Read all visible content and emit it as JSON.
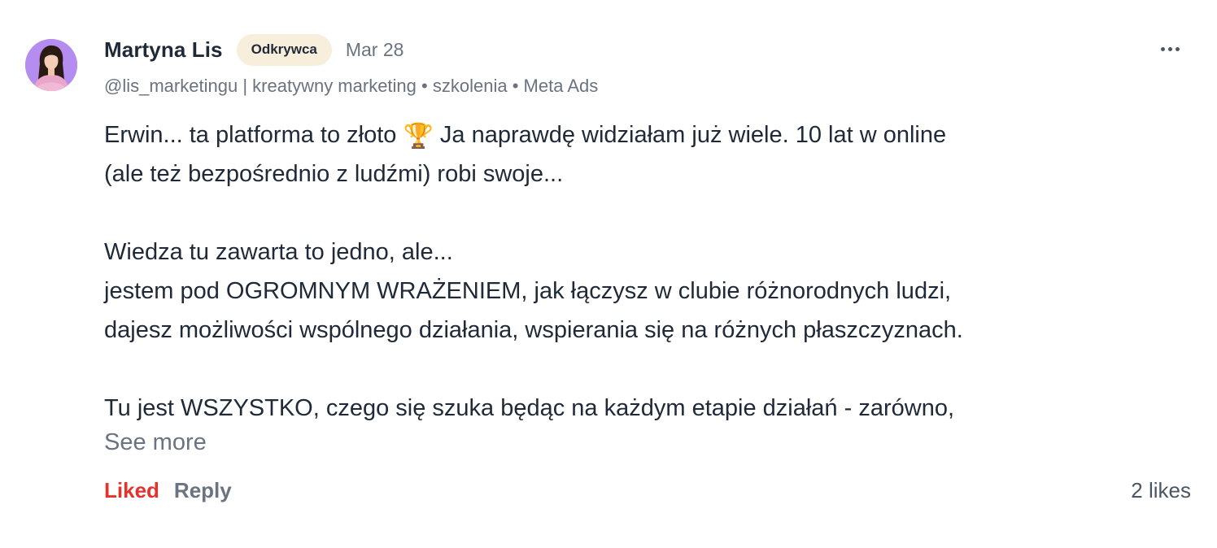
{
  "comment": {
    "author": {
      "name": "Martyna Lis",
      "badge": "Odkrywca",
      "date": "Mar 28",
      "handle": "@lis_marketingu",
      "separator": "|",
      "tagline_items": [
        "kreatywny marketing",
        "szkolenia",
        "Meta Ads"
      ],
      "tagline_bullet": "•"
    },
    "body": {
      "p1_before_emoji": "Erwin... ta platforma to złoto ",
      "emoji": "🏆",
      "p1_after_emoji": " Ja naprawdę widziałam już wiele. 10 lat  w online",
      "p1_line2": "(ale też bezpośrednio z ludźmi) robi swoje...",
      "p2_line1": "Wiedza tu zawarta to jedno, ale...",
      "p2_line2": "jestem pod OGROMNYM WRAŻENIEM, jak łączysz w clubie różnorodnych ludzi,",
      "p2_line3": "dajesz możliwości wspólnego działania, wspierania się na różnych płaszczyznach.",
      "p3_line1": "Tu jest WSZYSTKO, czego się szuka będąc na każdym etapie działań - zarówno,"
    },
    "see_more_label": "See more",
    "actions": {
      "liked_label": "Liked",
      "reply_label": "Reply",
      "likes_count": "2 likes"
    },
    "colors": {
      "liked": "#e5322d",
      "badge_bg": "#f8eedc",
      "avatar_bg": "#b58cf0",
      "muted_text": "#6b7280",
      "main_text": "#1f2937"
    },
    "icons": {
      "avatar": "avatar-photo",
      "more": "more-horizontal-icon",
      "trophy": "trophy-icon"
    }
  }
}
